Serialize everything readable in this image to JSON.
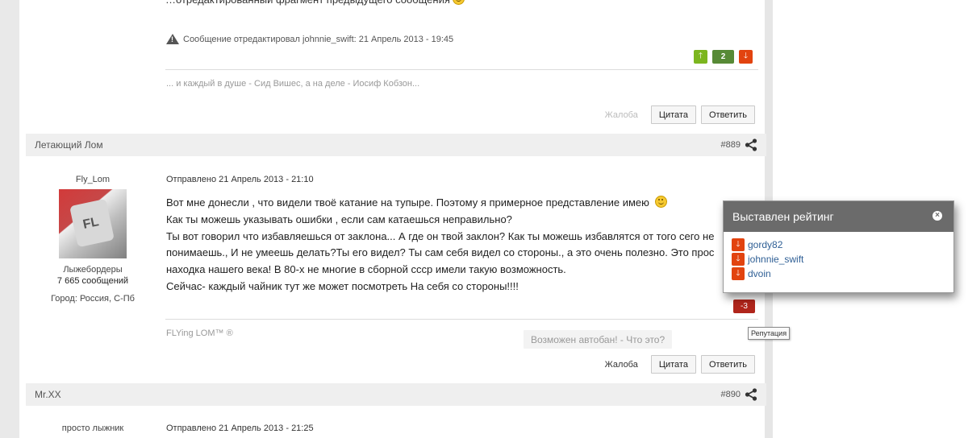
{
  "prev_post": {
    "edited_note": "Сообщение отредактировал johnnie_swift: 21 Апрель 2013 - 19:45",
    "reputation": {
      "value": "2"
    },
    "signature": "... и каждый в душе - Сид Вишес, а на деле - Иосиф Кобзон...",
    "actions": {
      "report": "Жалоба",
      "quote": "Цитата",
      "reply": "Ответить"
    }
  },
  "post_889": {
    "author": "Летающий Лом",
    "number": "#889",
    "user": {
      "name": "Fly_Lom",
      "group": "Лыжебордеры",
      "posts": "7 665 сообщений",
      "city_label": "Город:",
      "city": "Россия, С-Пб"
    },
    "posted": "Отправлено 21 Апрель 2013 - 21:10",
    "lines": [
      "Вот мне донесли , что видели твоё катание на тупыре. Поэтому я примерное представление имею",
      "Как ты можешь указывать ошибки , если сам катаешься неправильно?",
      "Ты вот говорил что избавляешься от заклона... А где он твой заклон? Как ты можешь избавлятся от того сего не",
      "понимаешь., И не умеешь делать?Ты его видел? Ты сам себя видел со стороны., а это очень полезно. Это прос",
      "находка нашего века! В 80-х не многие в сборной ссср имели такую возможность.",
      "Сейчас- каждый чайник тут же может посмотреть На себя со стороны!!!!"
    ],
    "reputation": {
      "value": "-3"
    },
    "signature": "FLYing LOM™ ®",
    "autoban": "Возможен автобан! - Что это?",
    "actions": {
      "report": "Жалоба",
      "quote": "Цитата",
      "reply": "Ответить"
    }
  },
  "post_890": {
    "author": "Mr.XX",
    "number": "#890",
    "user": {
      "name": "просто лыжник"
    },
    "posted": "Отправлено 21 Апрель 2013 - 21:25"
  },
  "rating_popup": {
    "title": "Выставлен рейтинг",
    "users": [
      "gordy82",
      "johnnie_swift",
      "dvoin"
    ]
  },
  "tooltip": "Репутация",
  "colors": {
    "rep_up": "#7cb61f",
    "rep_down": "#e2430f",
    "rep_positive": "#578a36",
    "rep_negative": "#b0251b",
    "popup_header": "#6b6b6b",
    "link": "#2f5f95"
  }
}
